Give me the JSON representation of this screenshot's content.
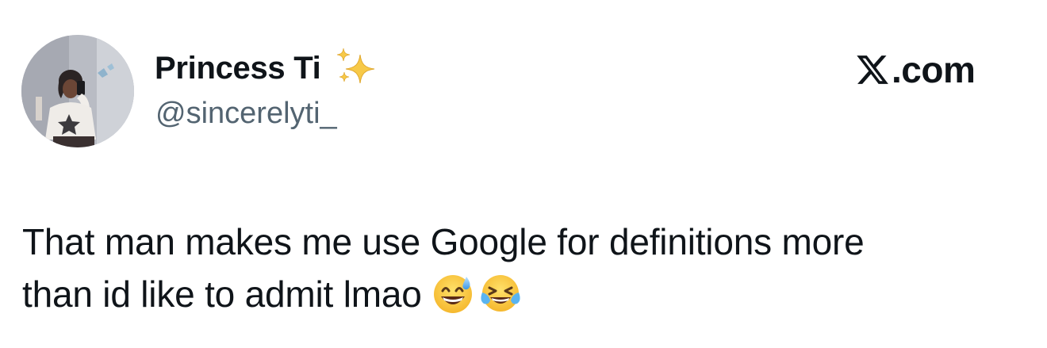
{
  "brand": {
    "name": "X.com",
    "icon": "x-logo-icon",
    "suffix": ".com"
  },
  "author": {
    "display_name": "Princess Ti",
    "name_emoji": "sparkles-icon",
    "handle": "@sincerelyti_",
    "avatar": "avatar"
  },
  "tweet": {
    "line1": "That man makes me use Google for definitions more",
    "line2": "than id like to admit lmao",
    "emojis": [
      "grinning-sweat-emoji-icon",
      "tears-of-joy-emoji-icon"
    ]
  },
  "colors": {
    "text_primary": "#0f1419",
    "text_secondary": "#536471",
    "background": "#ffffff",
    "sparkle": "#f7c948"
  }
}
